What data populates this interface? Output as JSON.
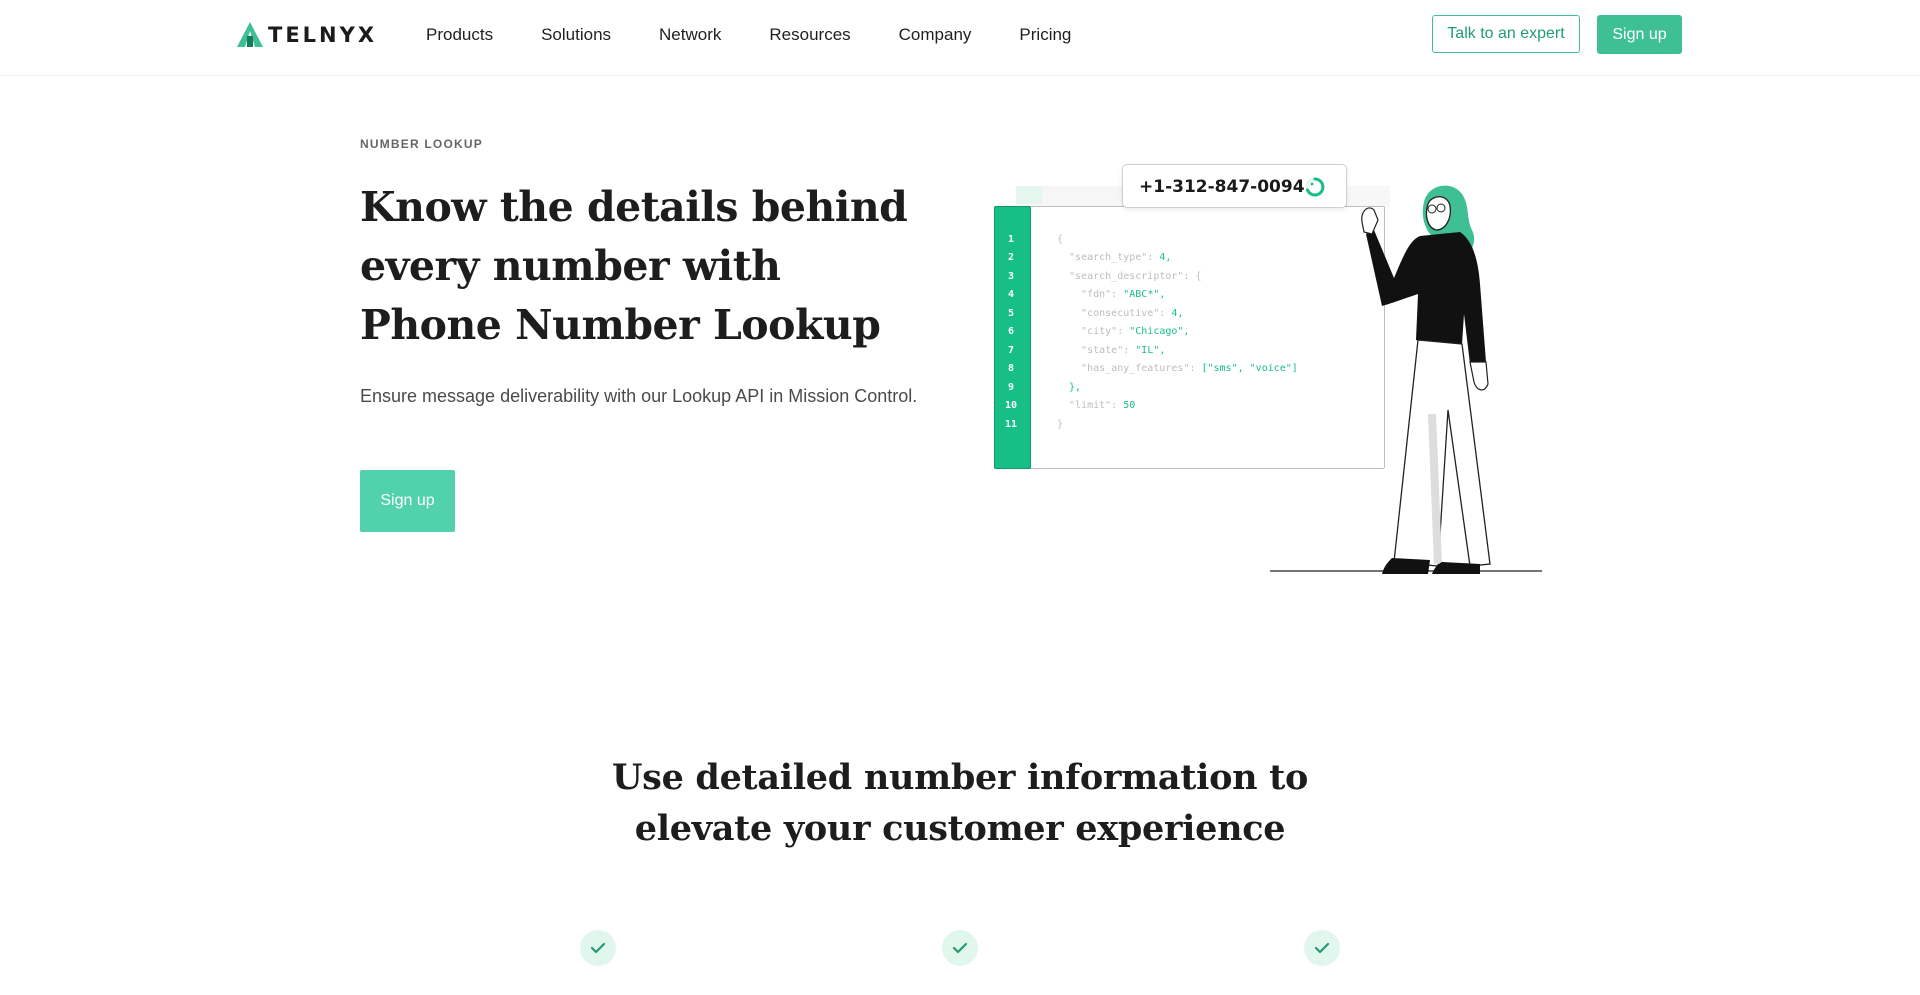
{
  "brand": {
    "logo_text": "TELNYX",
    "accent": "#3fbf94"
  },
  "nav": {
    "items": [
      {
        "label": "Products"
      },
      {
        "label": "Solutions"
      },
      {
        "label": "Network"
      },
      {
        "label": "Resources"
      },
      {
        "label": "Company"
      },
      {
        "label": "Pricing"
      }
    ],
    "talk_label": "Talk to an expert",
    "signup_label": "Sign up"
  },
  "hero": {
    "eyebrow": "NUMBER LOOKUP",
    "title": "Know the details behind every number with Phone Number Lookup",
    "subtitle": "Ensure message deliverability with our Lookup API in Mission Control.",
    "cta_label": "Sign up"
  },
  "illustration": {
    "phone_number": "+1-312-847-0094",
    "line_numbers": [
      "1",
      "2",
      "3",
      "4",
      "5",
      "6",
      "7",
      "8",
      "9",
      "10",
      "11"
    ],
    "code_lines": [
      {
        "text": "{"
      },
      {
        "text": "  \"search_type\": ",
        "value": "4,"
      },
      {
        "text": "  \"search_descriptor\": {"
      },
      {
        "text": "    \"fdn\": ",
        "value": "\"ABC*\","
      },
      {
        "text": "    \"consecutive\": ",
        "value": "4,"
      },
      {
        "text": "    \"city\": ",
        "value": "\"Chicago\","
      },
      {
        "text": "    \"state\": ",
        "value": "\"IL\","
      },
      {
        "text": "    \"has_any_features\": ",
        "value": "[\"sms\", \"voice\"]"
      },
      {
        "text": "  },",
        "value": ""
      },
      {
        "text": "  \"limit\": ",
        "value": "50"
      },
      {
        "text": "}"
      }
    ]
  },
  "features": {
    "title": "Use detailed number information to elevate your customer experience"
  }
}
